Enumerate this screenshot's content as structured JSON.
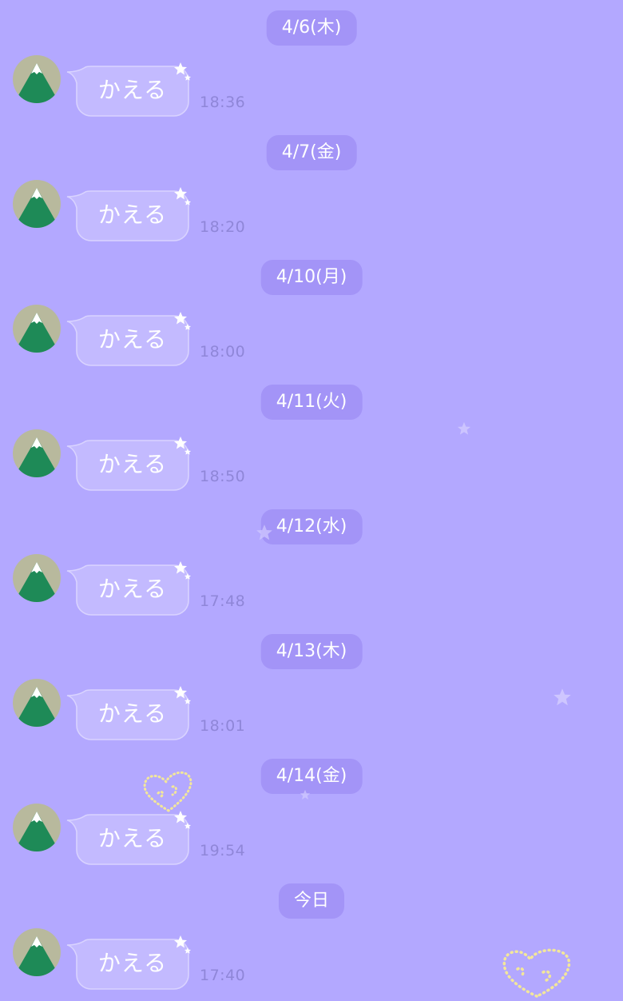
{
  "colors": {
    "background": "#b3a8ff",
    "date_pill": "#a394f7",
    "bubble_fill": "#c3baff",
    "bubble_border": "#d9d3ff",
    "time_text": "#8f86d8",
    "avatar_bg": "#b8b99d",
    "avatar_mountain": "#1e8a57",
    "heart_dots": "#f3e79a"
  },
  "icons": {
    "avatar": "mountain-avatar-icon",
    "bubble_sparkle": "sparkle-icon",
    "background_star": "star-icon",
    "background_heart": "dotted-heart-icon"
  },
  "messages": [
    {
      "date": "4/6(木)",
      "text": "かえる",
      "time": "18:36"
    },
    {
      "date": "4/7(金)",
      "text": "かえる",
      "time": "18:20"
    },
    {
      "date": "4/10(月)",
      "text": "かえる",
      "time": "18:00"
    },
    {
      "date": "4/11(火)",
      "text": "かえる",
      "time": "18:50"
    },
    {
      "date": "4/12(水)",
      "text": "かえる",
      "time": "17:48"
    },
    {
      "date": "4/13(木)",
      "text": "かえる",
      "time": "18:01"
    },
    {
      "date": "4/14(金)",
      "text": "かえる",
      "time": "19:54"
    },
    {
      "date": "今日",
      "text": "かえる",
      "time": "17:40"
    }
  ]
}
